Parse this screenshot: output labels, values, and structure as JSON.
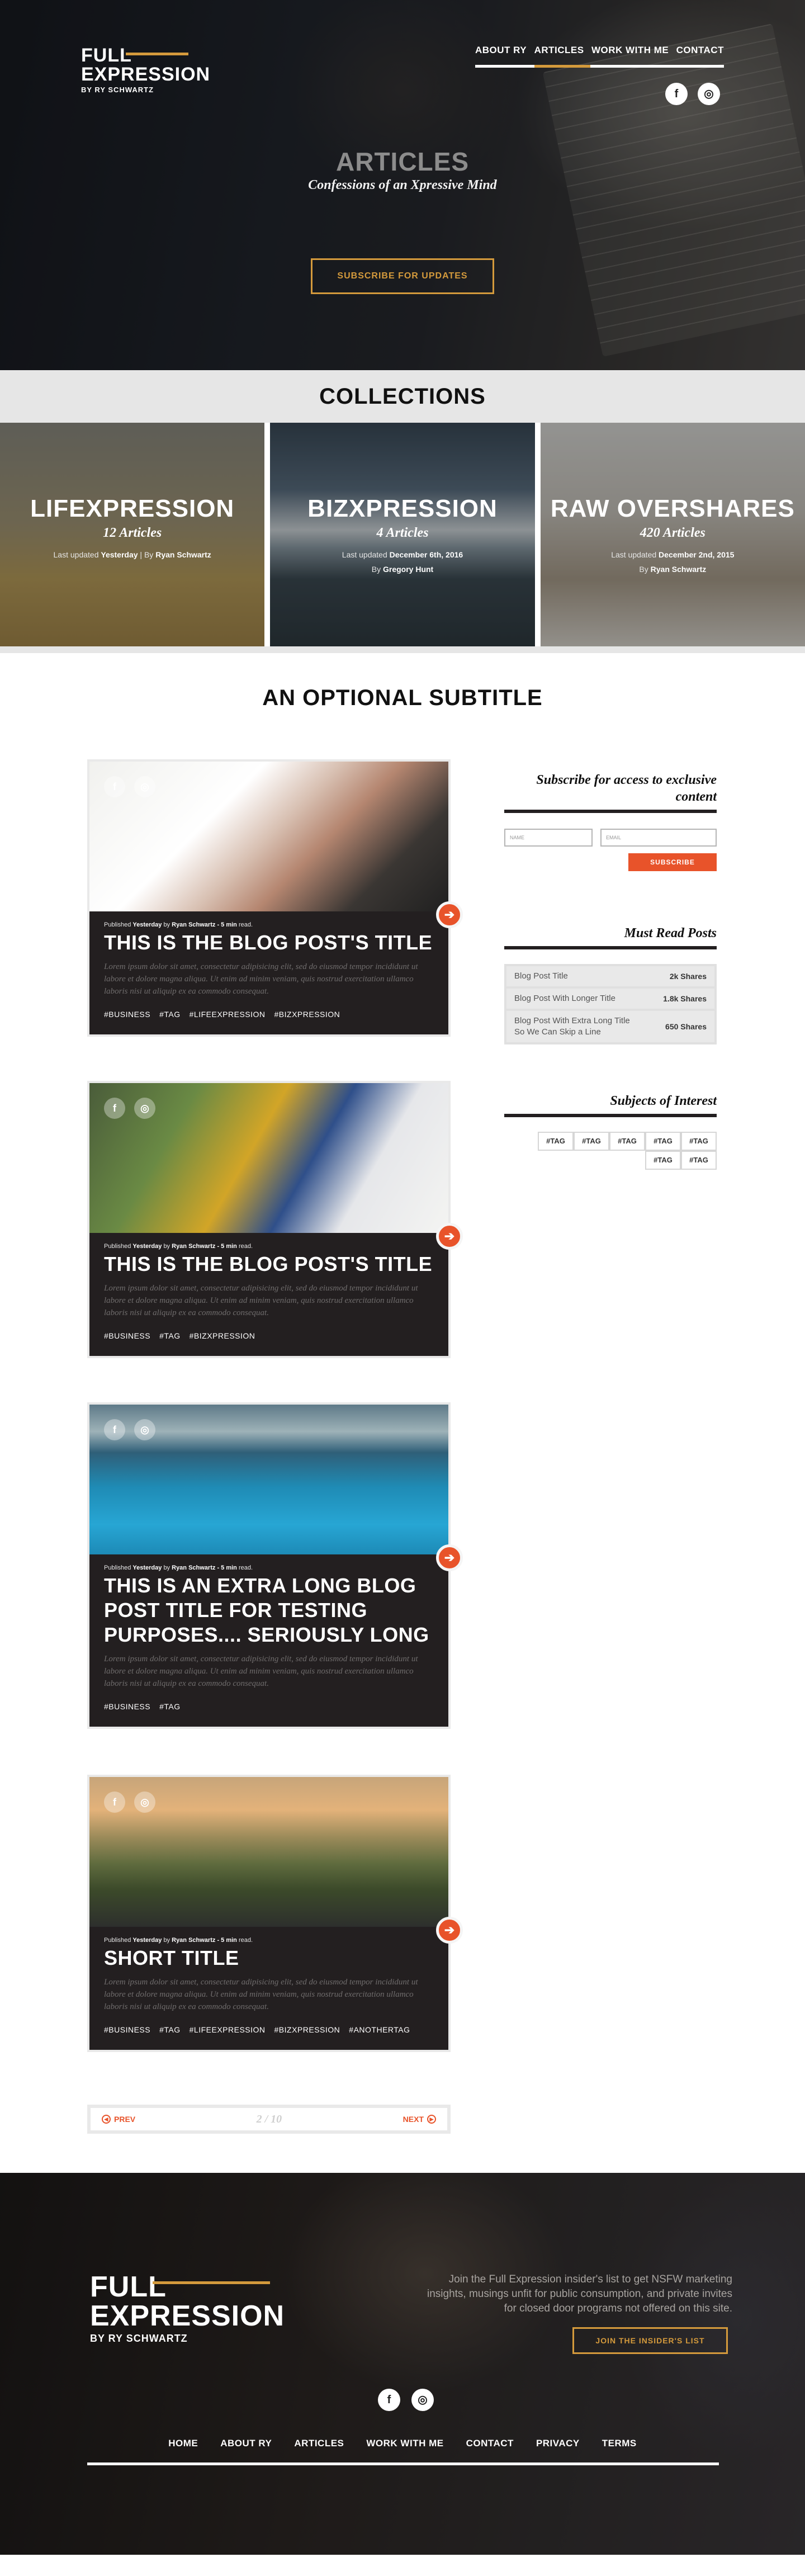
{
  "brand": {
    "line1": "FULL",
    "line2": "EXPRESSION",
    "byline": "BY RY SCHWARTZ"
  },
  "nav": [
    {
      "label": "ABOUT RY"
    },
    {
      "label": "ARTICLES",
      "active": true
    },
    {
      "label": "WORK WITH ME"
    },
    {
      "label": "CONTACT"
    }
  ],
  "social": {
    "facebook_icon": "f",
    "instagram_icon": "◎"
  },
  "hero": {
    "title": "ARTICLES",
    "subtitle": "Confessions of an Xpressive Mind",
    "button": "SUBSCRIBE FOR UPDATES"
  },
  "collections": {
    "heading": "COLLECTIONS",
    "items": [
      {
        "name": "LIFEXPRESSION",
        "count": "12 Articles",
        "updated_label": "Last updated",
        "updated": "Yesterday",
        "sep": " | By ",
        "author": "Ryan Schwartz"
      },
      {
        "name": "BIZXPRESSION",
        "count": "4 Articles",
        "updated_label": "Last updated",
        "updated": "December 6th, 2016",
        "by_label": "By",
        "author": "Gregory Hunt"
      },
      {
        "name": "RAW OVERSHARES",
        "count": "420 Articles",
        "updated_label": "Last updated",
        "updated": "December 2nd, 2015",
        "by_label": "By",
        "author": "Ryan Schwartz"
      }
    ]
  },
  "optional_subtitle": "AN OPTIONAL SUBTITLE",
  "posts": [
    {
      "meta_prefix": "Published",
      "meta_when": "Yesterday",
      "meta_by": "by",
      "meta_author": "Ryan Schwartz",
      "meta_read": "- 5 min",
      "meta_suffix": "read.",
      "title": "THIS IS THE BLOG POST'S TITLE",
      "excerpt": "Lorem ipsum dolor sit amet, consectetur adipisicing elit, sed do eiusmod tempor incididunt ut labore et dolore magna aliqua. Ut enim ad minim veniam, quis nostrud exercitation ullamco laboris nisi ut aliquip ex ea commodo consequat.",
      "tags": [
        "#BUSINESS",
        "#TAG",
        "#LIFEEXPRESSION",
        "#BIZXPRESSION"
      ]
    },
    {
      "meta_prefix": "Published",
      "meta_when": "Yesterday",
      "meta_by": "by",
      "meta_author": "Ryan Schwartz",
      "meta_read": "- 5 min",
      "meta_suffix": "read.",
      "title": "THIS IS THE BLOG POST'S TITLE",
      "excerpt": "Lorem ipsum dolor sit amet, consectetur adipisicing elit, sed do eiusmod tempor incididunt ut labore et dolore magna aliqua. Ut enim ad minim veniam, quis nostrud exercitation ullamco laboris nisi ut aliquip ex ea commodo consequat.",
      "tags": [
        "#BUSINESS",
        "#TAG",
        "#BIZXPRESSION"
      ]
    },
    {
      "meta_prefix": "Published",
      "meta_when": "Yesterday",
      "meta_by": "by",
      "meta_author": "Ryan Schwartz",
      "meta_read": "- 5 min",
      "meta_suffix": "read.",
      "title": "THIS IS AN EXTRA LONG BLOG POST TITLE FOR TESTING PURPOSES.... SERIOUSLY LONG",
      "excerpt": "Lorem ipsum dolor sit amet, consectetur adipisicing elit, sed do eiusmod tempor incididunt ut labore et dolore magna aliqua. Ut enim ad minim veniam, quis nostrud exercitation ullamco laboris nisi ut aliquip ex ea commodo consequat.",
      "tags": [
        "#BUSINESS",
        "#TAG"
      ]
    },
    {
      "meta_prefix": "Published",
      "meta_when": "Yesterday",
      "meta_by": "by",
      "meta_author": "Ryan Schwartz",
      "meta_read": "- 5 min",
      "meta_suffix": "read.",
      "title": "SHORT TITLE",
      "excerpt": "Lorem ipsum dolor sit amet, consectetur adipisicing elit, sed do eiusmod tempor incididunt ut labore et dolore magna aliqua. Ut enim ad minim veniam, quis nostrud exercitation ullamco laboris nisi ut aliquip ex ea commodo consequat.",
      "tags": [
        "#BUSINESS",
        "#TAG",
        "#LIFEEXPRESSION",
        "#BIZXPRESSION",
        "#ANOTHERTAG"
      ]
    }
  ],
  "pagination": {
    "prev": "PREV",
    "next": "NEXT",
    "count": "2 / 10",
    "prev_icon": "chevron-left-icon",
    "next_icon": "chevron-right-icon"
  },
  "sidebar": {
    "subscribe_heading": "Subscribe for access to exclusive content",
    "name_placeholder": "NAME",
    "email_placeholder": "EMAIL",
    "subscribe_button": "SUBSCRIBE",
    "must_read_heading": "Must Read Posts",
    "must_read": [
      {
        "title": "Blog Post Title",
        "shares": "2k Shares"
      },
      {
        "title": "Blog Post With Longer Title",
        "shares": "1.8k Shares"
      },
      {
        "title": "Blog Post With Extra Long Title So We Can Skip a Line",
        "shares": "650 Shares"
      }
    ],
    "subjects_heading": "Subjects of Interest",
    "tags": [
      "#TAG",
      "#TAG",
      "#TAG",
      "#TAG",
      "#TAG",
      "#TAG",
      "#TAG"
    ]
  },
  "footer": {
    "blurb": "Join the Full Expression insider's list to get NSFW marketing insights, musings unfit for public consumption, and private invites for closed door programs not offered on this site.",
    "button": "JOIN THE INSIDER'S LIST",
    "nav": [
      "HOME",
      "ABOUT RY",
      "ARTICLES",
      "WORK WITH ME",
      "CONTACT",
      "PRIVACY",
      "TERMS"
    ]
  },
  "colors": {
    "accent": "#d49a3c",
    "cta": "#e8532a",
    "dark": "#231f20",
    "light_gray": "#e6e6e6"
  }
}
